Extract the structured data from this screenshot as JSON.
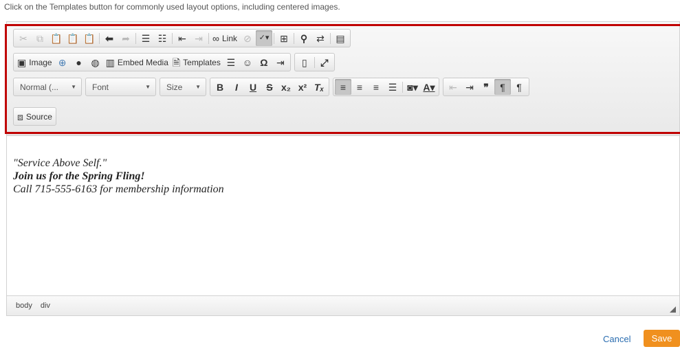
{
  "hint": "Click on the Templates button for commonly used layout options, including centered images.",
  "toolbar": {
    "link_label": "Link",
    "image_label": "Image",
    "embed_media_label": "Embed Media",
    "templates_label": "Templates",
    "format_combo": "Normal (...",
    "font_combo": "Font",
    "size_combo": "Size",
    "source_label": "Source",
    "glyph_bold": "B",
    "glyph_italic": "I",
    "glyph_underline": "U",
    "glyph_strike": "S",
    "glyph_omega": "Ω"
  },
  "content": {
    "line1": "\"Service Above Self.\"",
    "line2": "Join us for the Spring Fling!",
    "line3": "Call 715-555-6163 for membership information"
  },
  "statusbar": {
    "path": [
      "body",
      "div"
    ]
  },
  "actions": {
    "cancel_label": "Cancel",
    "save_label": "Save"
  },
  "colors": {
    "highlight": "#c00000",
    "save": "#f0901e",
    "link": "#2a6db0"
  }
}
